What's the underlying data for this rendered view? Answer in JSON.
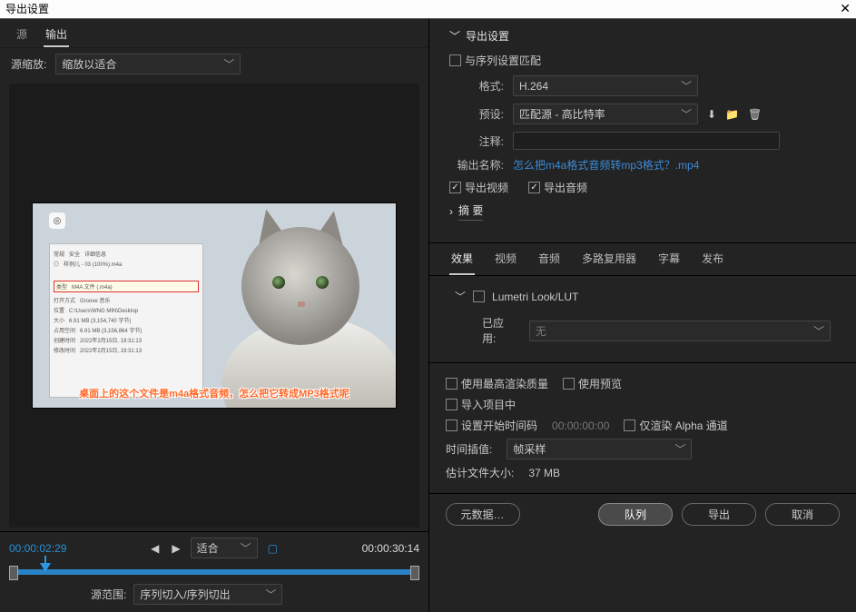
{
  "window": {
    "title": "导出设置"
  },
  "left": {
    "tabs": {
      "source": "源",
      "output": "输出"
    },
    "scale_label": "源缩放:",
    "scale_value": "缩放以适合",
    "preview_caption": "桌面上的这个文件是m4a格式音频，怎么把它转成MP3格式呢",
    "time": {
      "current": "00:00:02:29",
      "total": "00:00:30:14"
    },
    "fit_label": "适合",
    "range_label": "源范围:",
    "range_value": "序列切入/序列切出"
  },
  "settings": {
    "heading": "导出设置",
    "match_seq": "与序列设置匹配",
    "format_label": "格式:",
    "format_value": "H.264",
    "preset_label": "预设:",
    "preset_value": "匹配源 - 高比特率",
    "comment_label": "注释:",
    "outputname_label": "输出名称:",
    "outputname_value": "怎么把m4a格式音频转mp3格式？.mp4",
    "export_video": "导出视频",
    "export_audio": "导出音频",
    "summary": "摘 要"
  },
  "tabs": {
    "effects": "效果",
    "video": "视频",
    "audio": "音频",
    "mux": "多路复用器",
    "sub": "字幕",
    "pub": "发布"
  },
  "effects": {
    "lut": "Lumetri Look/LUT",
    "applied_label": "已应用:",
    "applied_value": "无"
  },
  "render": {
    "max_quality": "使用最高渲染质量",
    "use_preview": "使用预览",
    "import_project": "导入项目中",
    "set_start_tc": "设置开始时间码",
    "start_tc_val": "00:00:00:00",
    "alpha_only": "仅渲染 Alpha 通道",
    "interp_label": "时间插值:",
    "interp_value": "帧采样",
    "est_label": "估计文件大小:",
    "est_value": "37 MB"
  },
  "buttons": {
    "metadata": "元数据",
    "queue": "队列",
    "export": "导出",
    "cancel": "取消"
  }
}
